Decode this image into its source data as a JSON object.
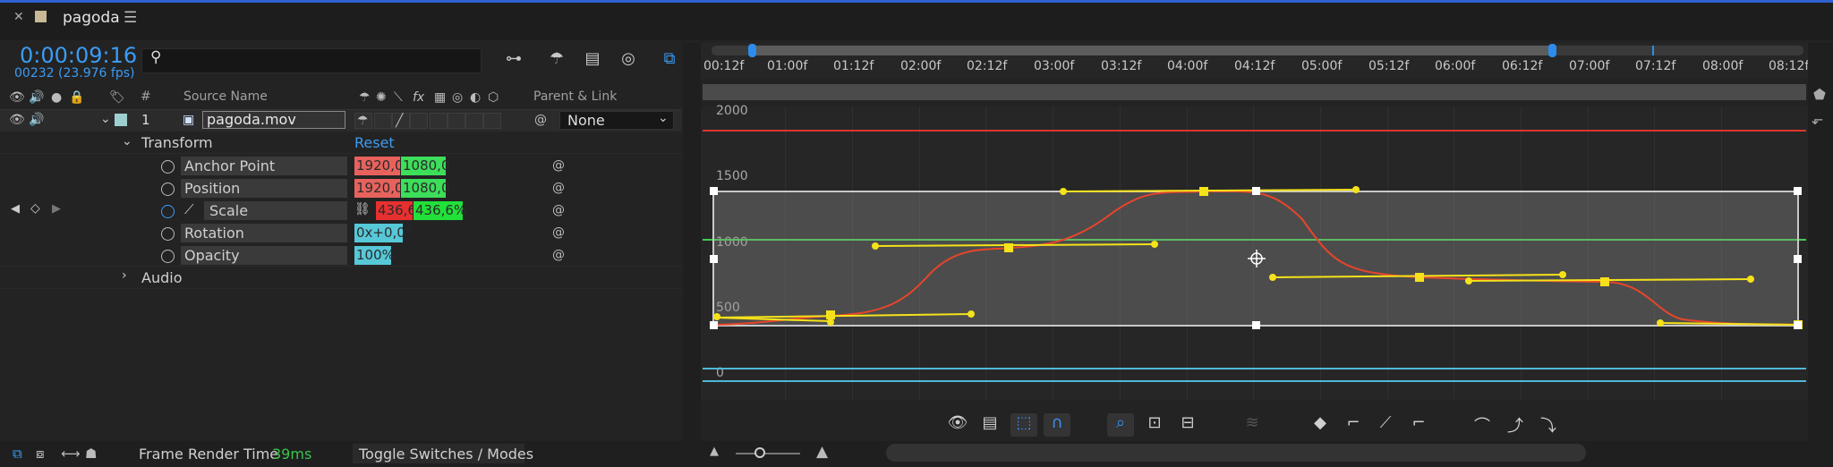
{
  "tab": {
    "title": "pagoda",
    "close_icon": "close-icon",
    "menu_icon": "hamburger-menu-icon",
    "swatch_color": "#c8b896"
  },
  "timeline": {
    "timecode": "0:00:09:16",
    "frame_info": "00232 (23.976 fps)",
    "search_placeholder": ""
  },
  "columns": {
    "number": "#",
    "source_name": "Source Name",
    "parent_link": "Parent & Link"
  },
  "layer": {
    "number": "1",
    "name": "pagoda.mov",
    "parent": "None",
    "label_color": "#9ecfcf"
  },
  "transform": {
    "label": "Transform",
    "reset": "Reset",
    "properties": [
      {
        "name": "Anchor Point",
        "values": [
          "1920,0",
          "1080,0"
        ],
        "colors": [
          "#e8625d",
          "#3dde5a"
        ]
      },
      {
        "name": "Position",
        "values": [
          "1920,0",
          "1080,0"
        ],
        "colors": [
          "#e8625d",
          "#3dde5a"
        ]
      },
      {
        "name": "Scale",
        "values": [
          "436,6",
          "436,6%"
        ],
        "colors": [
          "#e83030",
          "#22e03a"
        ]
      },
      {
        "name": "Rotation",
        "values": [
          "0x+0,0°"
        ],
        "colors": [
          "#56c8d8"
        ]
      },
      {
        "name": "Opacity",
        "values": [
          "100%"
        ],
        "colors": [
          "#56c8d8"
        ]
      }
    ]
  },
  "audio": {
    "label": "Audio"
  },
  "ruler": {
    "ticks": [
      "00:12f",
      "01:00f",
      "01:12f",
      "02:00f",
      "02:12f",
      "03:00f",
      "03:12f",
      "04:00f",
      "04:12f",
      "05:00f",
      "05:12f",
      "06:00f",
      "06:12f",
      "07:00f",
      "07:12f",
      "08:00f",
      "08:12f"
    ]
  },
  "graph": {
    "y_labels": [
      "2000",
      "1500",
      "1000",
      "500",
      "0"
    ],
    "line_colors": {
      "red_limit": "#e0352e",
      "green_ref": "#3ecf4a",
      "cyan_ref": "#4fb8d8",
      "curve": "#e8452a",
      "handles": "#f5e21a"
    }
  },
  "status": {
    "frame_render_label": "Frame Render Time",
    "frame_render_value": "39ms",
    "toggle_label": "Toggle Switches / Modes"
  }
}
